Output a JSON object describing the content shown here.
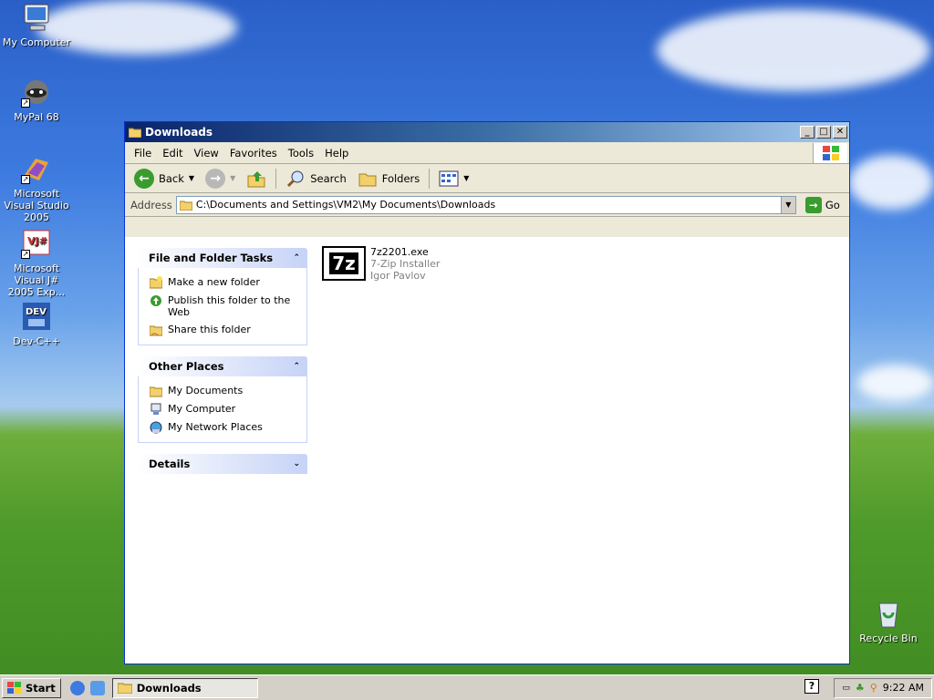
{
  "desktop": {
    "icons": [
      {
        "label": "My Computer"
      },
      {
        "label": "MyPal 68"
      },
      {
        "label": "Microsoft Visual Studio 2005"
      },
      {
        "label": "Microsoft Visual J# 2005 Exp..."
      },
      {
        "label": "Dev-C++"
      },
      {
        "label": "Recycle Bin"
      }
    ]
  },
  "window": {
    "title": "Downloads",
    "menu": [
      "File",
      "Edit",
      "View",
      "Favorites",
      "Tools",
      "Help"
    ],
    "toolbar": {
      "back": "Back",
      "search": "Search",
      "folders": "Folders"
    },
    "address": {
      "label": "Address",
      "value": "C:\\Documents and Settings\\VM2\\My Documents\\Downloads",
      "go": "Go"
    },
    "tasks": {
      "file_folder": {
        "title": "File and Folder Tasks",
        "items": [
          "Make a new folder",
          "Publish this folder to the Web",
          "Share this folder"
        ]
      },
      "other_places": {
        "title": "Other Places",
        "items": [
          "My Documents",
          "My Computer",
          "My Network Places"
        ]
      },
      "details": {
        "title": "Details"
      }
    },
    "files": [
      {
        "name": "7z2201.exe",
        "description": "7-Zip Installer",
        "company": "Igor Pavlov",
        "icon_text": "7z"
      }
    ]
  },
  "taskbar": {
    "start": "Start",
    "task": "Downloads",
    "help": "?",
    "clock": "9:22 AM"
  },
  "colors": {
    "titlebar": "#0a246a",
    "panel_head": "#c6d3f7",
    "desktop_sky": "#3d7be0",
    "desktop_grass": "#4e9a2a"
  }
}
